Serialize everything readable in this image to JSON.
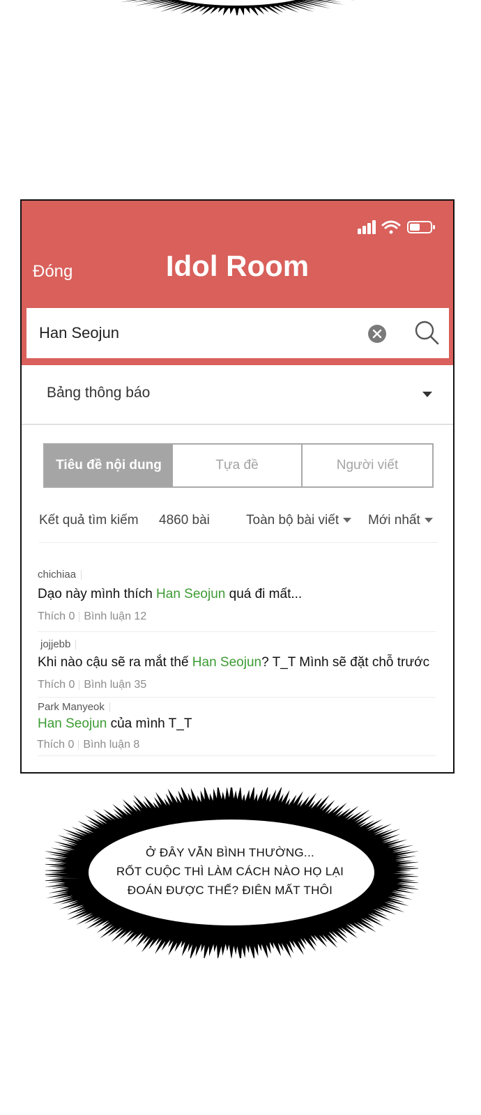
{
  "app": {
    "close_label": "Đóng",
    "title": "Idol Room",
    "accent_color": "#d9605b",
    "highlight_color": "#3d9b33"
  },
  "status_bar": {
    "icons": [
      "signal-icon",
      "wifi-icon",
      "battery-icon"
    ]
  },
  "search": {
    "value": "Han Seojun",
    "clear_icon": "clear-icon",
    "submit_icon": "search-icon"
  },
  "board": {
    "selected": "Bảng thông báo"
  },
  "tabs": [
    {
      "label": "Tiêu đề nội dung",
      "active": true
    },
    {
      "label": "Tựa đề",
      "active": false
    },
    {
      "label": "Người viết",
      "active": false
    }
  ],
  "results": {
    "label": "Kết quả tìm kiếm",
    "count": "4860 bài",
    "filter_scope": "Toàn bộ bài viết",
    "filter_sort": "Mới nhất"
  },
  "posts": [
    {
      "author": "chichiaa",
      "title_before": "Dạo này mình thích ",
      "title_highlight": "Han Seojun",
      "title_after": " quá đi mất...",
      "likes": "Thích 0",
      "comments": "Bình luận 12"
    },
    {
      "author": "jojjebb",
      "title_before": "Khi nào cậu sẽ ra mắt thế ",
      "title_highlight": "Han Seojun",
      "title_after": "? T_T Mình sẽ đặt chỗ trước",
      "likes": "Thích 0",
      "comments": "Bình luận 35"
    },
    {
      "author": "Park Manyeok",
      "title_before": "",
      "title_highlight": "Han Seojun",
      "title_after": " của mình T_T",
      "likes": "Thích 0",
      "comments": "Bình luận 8"
    }
  ],
  "speech_bubble": {
    "lines": [
      "Ở ĐÂY VẪN BÌNH THƯỜNG...",
      "RỐT CUỘC THÌ LÀM CÁCH NÀO HỌ LẠI",
      "ĐOÁN ĐƯỢC THẾ? ĐIÊN MẤT THÔI"
    ]
  }
}
